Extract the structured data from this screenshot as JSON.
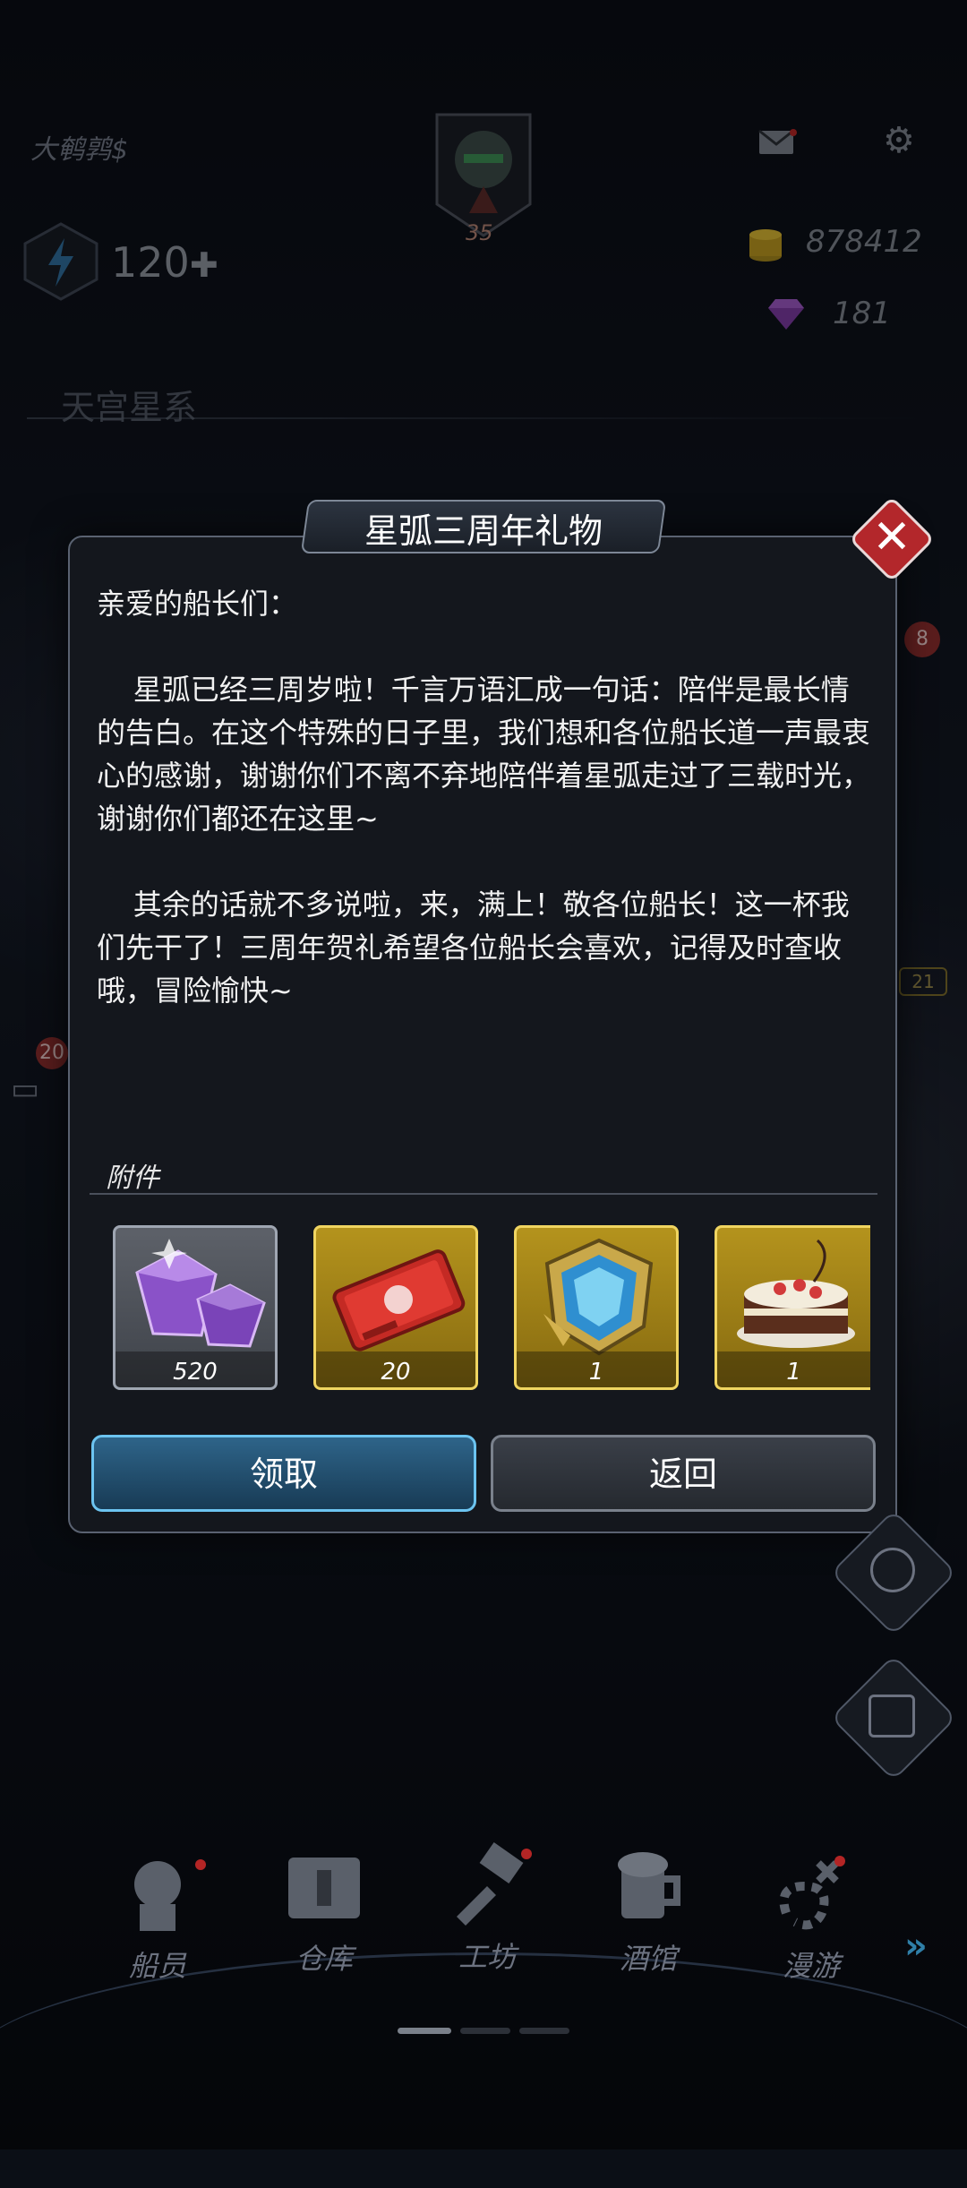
{
  "hud": {
    "player_name": "大鹌鹑$",
    "level": "35",
    "energy": "120",
    "energy_plus": "✚",
    "gold": "878412",
    "gems": "181",
    "galaxy_name": "天宫星系",
    "side_badge_top": "8",
    "side_badge_left": "20",
    "side_badge_right": "21"
  },
  "dialog": {
    "title": "星弧三周年礼物",
    "close_symbol": "✕",
    "body": "亲爱的船长们：\n\n    星弧已经三周岁啦！千言万语汇成一句话：陪伴是最长情的告白。在这个特殊的日子里，我们想和各位船长道一声最衷心的感谢，谢谢你们不离不弃地陪伴着星弧走过了三载时光，谢谢你们都还在这里~\n\n    其余的话就不多说啦，来，满上！敬各位船长！这一杯我们先干了！三周年贺礼希望各位船长会喜欢，记得及时查收哦，冒险愉快~",
    "attachments_label": "附件",
    "attachments": [
      {
        "name": "purple-gems",
        "count": "520"
      },
      {
        "name": "red-ticket",
        "count": "20"
      },
      {
        "name": "blue-shield-badge",
        "count": "1"
      },
      {
        "name": "anniversary-cake",
        "count": "1"
      }
    ],
    "claim_label": "领取",
    "back_label": "返回"
  },
  "nav": {
    "items": [
      {
        "label": "船员",
        "icon": "crew-icon"
      },
      {
        "label": "仓库",
        "icon": "warehouse-icon"
      },
      {
        "label": "工坊",
        "icon": "workshop-icon"
      },
      {
        "label": "酒馆",
        "icon": "tavern-icon"
      },
      {
        "label": "漫游",
        "icon": "roam-icon"
      }
    ]
  },
  "colors": {
    "claim_border": "#6cc4f0",
    "gold_item": "#b4931d",
    "close_red": "#b3272b"
  }
}
